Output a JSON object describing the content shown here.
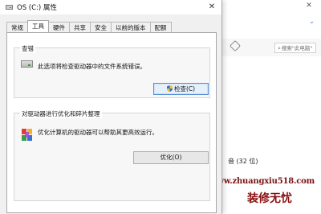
{
  "background": {
    "search_placeholder": "搜索\"此电脑\"",
    "storage_label": "音 (32 位)",
    "watermark_url": "www.zhuangxiu518.com",
    "watermark_name": "装修无忧"
  },
  "dialog": {
    "title": "OS (C:) 属性",
    "tabs": [
      "常规",
      "工具",
      "硬件",
      "共享",
      "安全",
      "以前的版本",
      "配额"
    ],
    "active_tab": "工具",
    "check_group": {
      "title": "查错",
      "description": "此选项将检查驱动器中的文件系统错误。",
      "button_label": "检查(C)"
    },
    "optimize_group": {
      "title": "对驱动器进行优化和碎片整理",
      "description": "优化计算机的驱动器可以帮助其更高效运行。",
      "button_label": "优化(O)"
    }
  },
  "icons": {
    "close": "close-icon",
    "drive": "drive-icon",
    "shield": "shield-icon",
    "defrag": "defrag-icon",
    "search": "search-icon"
  },
  "colors": {
    "dialog_bg": "#f0f0f0",
    "panel_bg": "#ffffff",
    "focus_border": "#5a8fd6",
    "watermark": "#8a1010"
  }
}
